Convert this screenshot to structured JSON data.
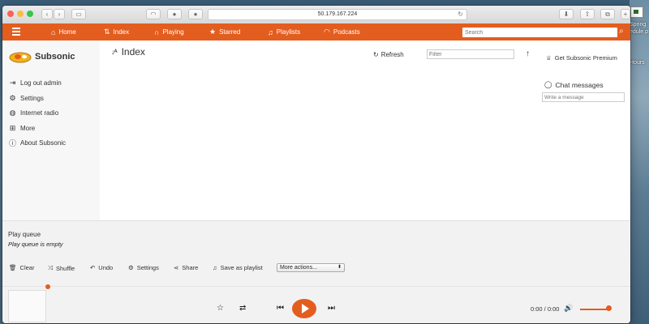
{
  "browser": {
    "url": "50.179.167.224"
  },
  "desktop": {
    "labels": [
      "Spring",
      "edule.p",
      "Hours"
    ]
  },
  "navbar": {
    "items": [
      {
        "label": "Home",
        "icon": "home-icon"
      },
      {
        "label": "Index",
        "icon": "sort-icon"
      },
      {
        "label": "Playing",
        "icon": "headphones-icon"
      },
      {
        "label": "Starred",
        "icon": "star-icon"
      },
      {
        "label": "Playlists",
        "icon": "music-icon"
      },
      {
        "label": "Podcasts",
        "icon": "rss-icon"
      }
    ],
    "search_placeholder": "Search"
  },
  "sidebar": {
    "logo_text": "Subsonic",
    "items": [
      {
        "label": "Log out admin",
        "icon": "logout-icon"
      },
      {
        "label": "Settings",
        "icon": "gear-icon"
      },
      {
        "label": "Internet radio",
        "icon": "globe-icon"
      },
      {
        "label": "More",
        "icon": "plus-square-icon"
      },
      {
        "label": "About Subsonic",
        "icon": "info-icon"
      }
    ]
  },
  "main": {
    "title": "Index",
    "refresh_label": "Refresh",
    "filter_placeholder": "Filter"
  },
  "rightpanel": {
    "premium_label": "Get Subsonic Premium",
    "chat_title": "Chat messages",
    "chat_placeholder": "Write a message"
  },
  "queue": {
    "title": "Play queue",
    "empty_text": "Play queue is empty",
    "buttons": [
      {
        "label": "Clear",
        "icon": "trash-icon"
      },
      {
        "label": "Shuffle",
        "icon": "shuffle-icon"
      },
      {
        "label": "Undo",
        "icon": "undo-icon"
      },
      {
        "label": "Settings",
        "icon": "gear-icon"
      },
      {
        "label": "Share",
        "icon": "share-icon"
      },
      {
        "label": "Save as playlist",
        "icon": "music-icon"
      }
    ],
    "more_actions": "More actions..."
  },
  "player": {
    "time": "0:00 / 0:00",
    "progress": 0,
    "volume": 0.85
  },
  "colors": {
    "accent": "#e35d1f"
  }
}
